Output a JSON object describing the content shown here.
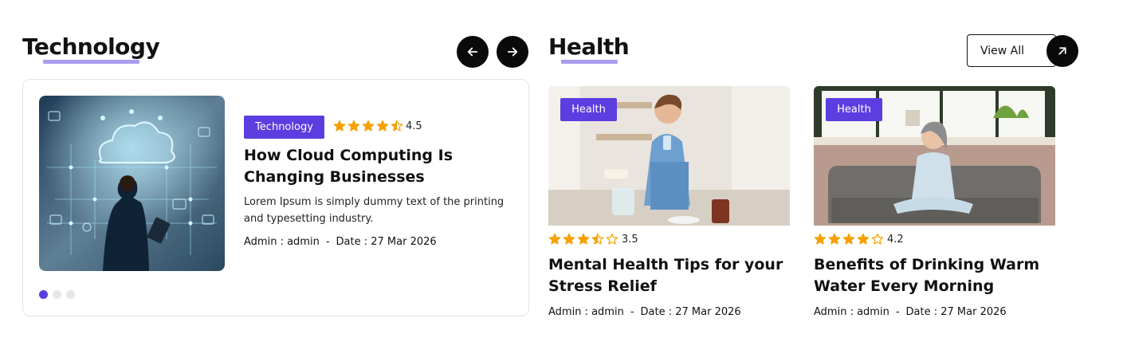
{
  "technology": {
    "title": "Technology",
    "prev_icon": "arrow-left-icon",
    "next_icon": "arrow-right-icon",
    "card": {
      "category": "Technology",
      "rating": "4.5",
      "rating_value": 4.5,
      "title": "How Cloud Computing Is Changing Businesses",
      "description": "Lorem Ipsum is simply dummy text of the printing and typesetting industry.",
      "author": "Admin : admin",
      "separator": "-",
      "date": "Date : 27 Mar 2026"
    },
    "slides_count": 3,
    "active_slide": 1
  },
  "health": {
    "title": "Health",
    "view_all_label": "View All",
    "view_all_icon": "arrow-up-right-icon",
    "posts": [
      {
        "category": "Health",
        "rating": "3.5",
        "rating_value": 3.5,
        "title": "Mental Health Tips for your Stress Relief",
        "author": "Admin : admin",
        "separator": "-",
        "date": "Date : 27 Mar 2026"
      },
      {
        "category": "Health",
        "rating": "4.2",
        "rating_value": 4.2,
        "title": "Benefits of Drinking Warm Water Every Morning",
        "author": "Admin : admin",
        "separator": "-",
        "date": "Date : 27 Mar 2026"
      }
    ]
  },
  "colors": {
    "accent": "#5b3de0",
    "underline": "#a99cf0",
    "star": "#f5a100",
    "button_dark": "#0a0a0a"
  }
}
